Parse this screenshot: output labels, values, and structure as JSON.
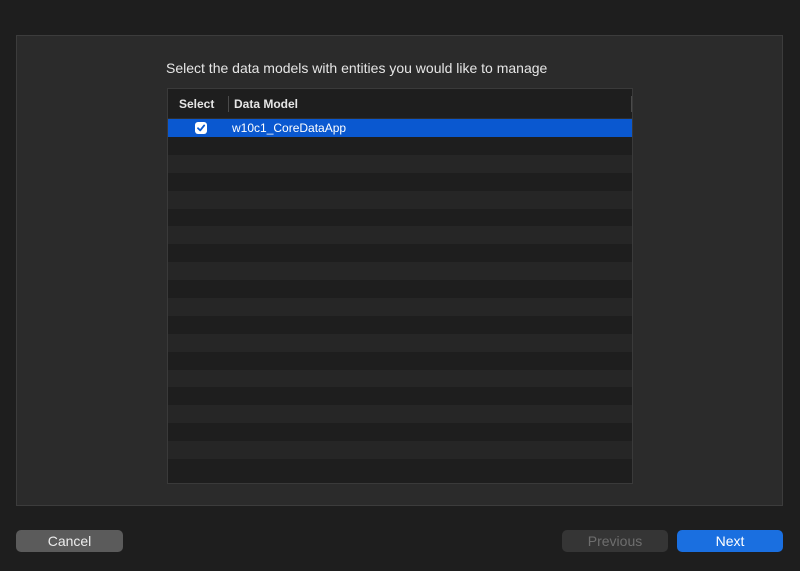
{
  "dialog": {
    "prompt": "Select the data models with entities you would like to manage"
  },
  "table": {
    "columns": [
      "Select",
      "Data Model"
    ],
    "rows": [
      {
        "selected": true,
        "checked": true,
        "data_model": "w10c1_CoreDataApp"
      }
    ]
  },
  "buttons": {
    "cancel": "Cancel",
    "previous": "Previous",
    "next": "Next"
  },
  "colors": {
    "selection": "#0a58d0",
    "primary_button": "#1a6fe0"
  },
  "icons": {
    "checkbox": "checkmark-icon"
  }
}
